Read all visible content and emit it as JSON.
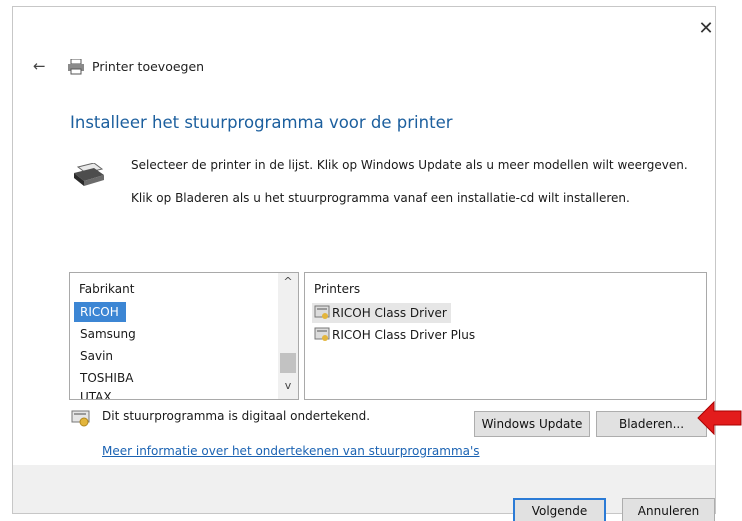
{
  "window": {
    "title": "Printer toevoegen",
    "close_symbol": "✕",
    "back_symbol": "←"
  },
  "heading": "Installeer het stuurprogramma voor de printer",
  "description": {
    "line1": "Selecteer de printer in de lijst. Klik op Windows Update als u meer modellen wilt weergeven.",
    "line2": "Klik op Bladeren als u het stuurprogramma vanaf een installatie-cd wilt installeren."
  },
  "manufacturers": {
    "header": "Fabrikant",
    "items": [
      "RICOH",
      "Samsung",
      "Savin",
      "TOSHIBA",
      "UTAX"
    ],
    "selected": "RICOH"
  },
  "printers": {
    "header": "Printers",
    "items": [
      "RICOH Class Driver",
      "RICOH Class Driver Plus"
    ],
    "selected": "RICOH Class Driver"
  },
  "signature": {
    "status": "Dit stuurprogramma is digitaal ondertekend.",
    "link": "Meer informatie over het ondertekenen van stuurprogramma's"
  },
  "buttons": {
    "windows_update": "Windows Update",
    "browse": "Bladeren...",
    "next": "Volgende",
    "cancel": "Annuleren"
  },
  "scroll": {
    "up": "^",
    "down": "v"
  },
  "colors": {
    "heading": "#1c5f9e",
    "selection": "#3c86d4",
    "link": "#1b63b3",
    "arrow": "#e31c1c"
  }
}
